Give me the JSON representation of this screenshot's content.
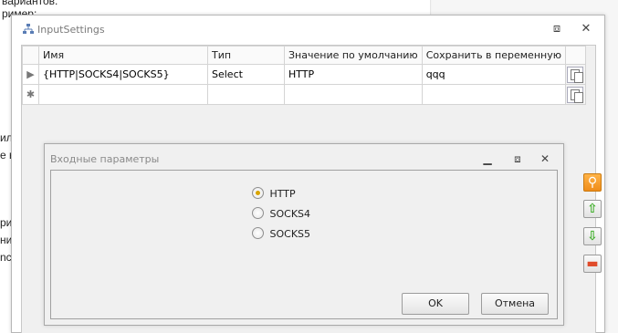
{
  "background": {
    "fragments": [
      "вариантов.",
      "ример:",
      "ил",
      "е в",
      "ри",
      "ни",
      "nc"
    ]
  },
  "window": {
    "title": "InputSettings",
    "icons": {
      "app": "tree-network-icon",
      "restore": "restore-icon",
      "close": "close-icon"
    }
  },
  "grid": {
    "columns": [
      "Имя",
      "Тип",
      "Значение по умолчанию",
      "Сохранить в переменную"
    ],
    "rows": [
      {
        "indicator": "▶",
        "name": "{HTTP|SOCKS4|SOCKS5}",
        "type": "Select",
        "default": "HTTP",
        "variable": "qqq"
      }
    ],
    "new_row_indicator": "✱"
  },
  "side_buttons": [
    {
      "name": "search",
      "icon": "magnifier-icon",
      "color": "#f0a030"
    },
    {
      "name": "move-up",
      "icon": "arrow-up-icon",
      "color": "#3fae2a"
    },
    {
      "name": "move-down",
      "icon": "arrow-down-icon",
      "color": "#3fae2a"
    },
    {
      "name": "remove",
      "icon": "minus-icon",
      "color": "#e04b2a"
    }
  ],
  "dialog": {
    "title": "Входные параметры",
    "options": [
      "HTTP",
      "SOCKS4",
      "SOCKS5"
    ],
    "selected": "HTTP",
    "ok_label": "OK",
    "cancel_label": "Отмена"
  },
  "colors": {
    "accent": "#d8a400"
  }
}
